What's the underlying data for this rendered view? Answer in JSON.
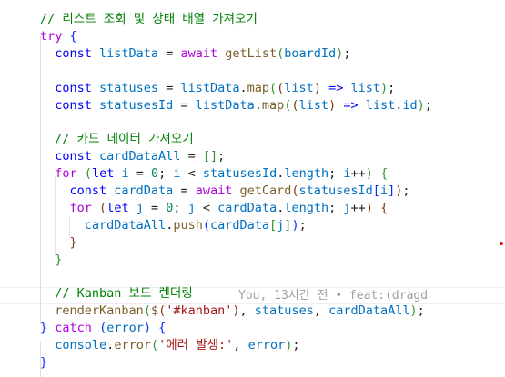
{
  "editor": {
    "lines": [
      [
        {
          "t": "// 리스트 조회 및 상태 배열 가져오기",
          "c": "comment"
        }
      ],
      [
        {
          "t": "try",
          "c": "keyword"
        },
        {
          "t": " {",
          "c": "b1"
        }
      ],
      [
        {
          "t": "  "
        },
        {
          "t": "const",
          "c": "decl"
        },
        {
          "t": " listData",
          "c": "var"
        },
        {
          "t": " = "
        },
        {
          "t": "await",
          "c": "keyword"
        },
        {
          "t": " getList",
          "c": "fn"
        },
        {
          "t": "(",
          "c": "b2"
        },
        {
          "t": "boardId",
          "c": "var"
        },
        {
          "t": ")",
          "c": "b2"
        },
        {
          "t": ";"
        }
      ],
      [],
      [
        {
          "t": "  "
        },
        {
          "t": "const",
          "c": "decl"
        },
        {
          "t": " statuses",
          "c": "var"
        },
        {
          "t": " = "
        },
        {
          "t": "listData",
          "c": "var"
        },
        {
          "t": "."
        },
        {
          "t": "map",
          "c": "fn"
        },
        {
          "t": "(",
          "c": "b2"
        },
        {
          "t": "(",
          "c": "b3"
        },
        {
          "t": "list",
          "c": "var"
        },
        {
          "t": ")",
          "c": "b3"
        },
        {
          "t": " "
        },
        {
          "t": "=>",
          "c": "decl"
        },
        {
          "t": " list",
          "c": "var"
        },
        {
          "t": ")",
          "c": "b2"
        },
        {
          "t": ";"
        }
      ],
      [
        {
          "t": "  "
        },
        {
          "t": "const",
          "c": "decl"
        },
        {
          "t": " statusesId",
          "c": "var"
        },
        {
          "t": " = "
        },
        {
          "t": "listData",
          "c": "var"
        },
        {
          "t": "."
        },
        {
          "t": "map",
          "c": "fn"
        },
        {
          "t": "(",
          "c": "b2"
        },
        {
          "t": "(",
          "c": "b3"
        },
        {
          "t": "list",
          "c": "var"
        },
        {
          "t": ")",
          "c": "b3"
        },
        {
          "t": " "
        },
        {
          "t": "=>",
          "c": "decl"
        },
        {
          "t": " list",
          "c": "var"
        },
        {
          "t": "."
        },
        {
          "t": "id",
          "c": "var"
        },
        {
          "t": ")",
          "c": "b2"
        },
        {
          "t": ";"
        }
      ],
      [],
      [
        {
          "t": "  "
        },
        {
          "t": "// 카드 데이터 가져오기",
          "c": "comment"
        }
      ],
      [
        {
          "t": "  "
        },
        {
          "t": "const",
          "c": "decl"
        },
        {
          "t": " cardDataAll",
          "c": "var"
        },
        {
          "t": " = "
        },
        {
          "t": "[]",
          "c": "b2"
        },
        {
          "t": ";"
        }
      ],
      [
        {
          "t": "  "
        },
        {
          "t": "for",
          "c": "keyword"
        },
        {
          "t": " "
        },
        {
          "t": "(",
          "c": "b2"
        },
        {
          "t": "let",
          "c": "decl"
        },
        {
          "t": " i",
          "c": "var"
        },
        {
          "t": " = "
        },
        {
          "t": "0",
          "c": "number"
        },
        {
          "t": "; "
        },
        {
          "t": "i",
          "c": "var"
        },
        {
          "t": " < "
        },
        {
          "t": "statusesId",
          "c": "var"
        },
        {
          "t": "."
        },
        {
          "t": "length",
          "c": "var"
        },
        {
          "t": "; "
        },
        {
          "t": "i",
          "c": "var"
        },
        {
          "t": "++"
        },
        {
          "t": ")",
          "c": "b2"
        },
        {
          "t": " "
        },
        {
          "t": "{",
          "c": "b2"
        }
      ],
      [
        {
          "t": "    "
        },
        {
          "t": "const",
          "c": "decl"
        },
        {
          "t": " cardData",
          "c": "var"
        },
        {
          "t": " = "
        },
        {
          "t": "await",
          "c": "keyword"
        },
        {
          "t": " getCard",
          "c": "fn"
        },
        {
          "t": "(",
          "c": "b3"
        },
        {
          "t": "statusesId",
          "c": "var"
        },
        {
          "t": "[",
          "c": "b1"
        },
        {
          "t": "i",
          "c": "var"
        },
        {
          "t": "]",
          "c": "b1"
        },
        {
          "t": ")",
          "c": "b3"
        },
        {
          "t": ";"
        }
      ],
      [
        {
          "t": "    "
        },
        {
          "t": "for",
          "c": "keyword"
        },
        {
          "t": " "
        },
        {
          "t": "(",
          "c": "b3"
        },
        {
          "t": "let",
          "c": "decl"
        },
        {
          "t": " j",
          "c": "var"
        },
        {
          "t": " = "
        },
        {
          "t": "0",
          "c": "number"
        },
        {
          "t": "; "
        },
        {
          "t": "j",
          "c": "var"
        },
        {
          "t": " < "
        },
        {
          "t": "cardData",
          "c": "var"
        },
        {
          "t": "."
        },
        {
          "t": "length",
          "c": "var"
        },
        {
          "t": "; "
        },
        {
          "t": "j",
          "c": "var"
        },
        {
          "t": "++"
        },
        {
          "t": ")",
          "c": "b3"
        },
        {
          "t": " "
        },
        {
          "t": "{",
          "c": "b3"
        }
      ],
      [
        {
          "t": "      "
        },
        {
          "t": "cardDataAll",
          "c": "var"
        },
        {
          "t": "."
        },
        {
          "t": "push",
          "c": "fn"
        },
        {
          "t": "(",
          "c": "b1"
        },
        {
          "t": "cardData",
          "c": "var"
        },
        {
          "t": "[",
          "c": "b2"
        },
        {
          "t": "j",
          "c": "var"
        },
        {
          "t": "]",
          "c": "b2"
        },
        {
          "t": ")",
          "c": "b1"
        },
        {
          "t": ";"
        }
      ],
      [
        {
          "t": "    "
        },
        {
          "t": "}",
          "c": "b3"
        }
      ],
      [
        {
          "t": "  "
        },
        {
          "t": "}",
          "c": "b2"
        }
      ],
      [],
      [
        {
          "t": "  "
        },
        {
          "t": "// Kanban 보드 렌더링",
          "c": "comment"
        }
      ],
      [
        {
          "t": "  "
        },
        {
          "t": "renderKanban",
          "c": "fn"
        },
        {
          "t": "(",
          "c": "b2"
        },
        {
          "t": "$",
          "c": "fn"
        },
        {
          "t": "(",
          "c": "b3"
        },
        {
          "t": "'#kanban'",
          "c": "string"
        },
        {
          "t": ")",
          "c": "b3"
        },
        {
          "t": ", "
        },
        {
          "t": "statuses",
          "c": "var"
        },
        {
          "t": ", "
        },
        {
          "t": "cardDataAll",
          "c": "var"
        },
        {
          "t": ")",
          "c": "b2"
        },
        {
          "t": ";"
        }
      ],
      [
        {
          "t": "}",
          "c": "b1"
        },
        {
          "t": " "
        },
        {
          "t": "catch",
          "c": "keyword"
        },
        {
          "t": " "
        },
        {
          "t": "(",
          "c": "b1"
        },
        {
          "t": "error",
          "c": "var"
        },
        {
          "t": ")",
          "c": "b1"
        },
        {
          "t": " "
        },
        {
          "t": "{",
          "c": "b1"
        }
      ],
      [
        {
          "t": "  "
        },
        {
          "t": "console",
          "c": "var"
        },
        {
          "t": "."
        },
        {
          "t": "error",
          "c": "fn"
        },
        {
          "t": "(",
          "c": "b2"
        },
        {
          "t": "'에러 발생:'",
          "c": "string"
        },
        {
          "t": ", "
        },
        {
          "t": "error",
          "c": "var"
        },
        {
          "t": ")",
          "c": "b2"
        },
        {
          "t": ";"
        }
      ],
      [
        {
          "t": "}",
          "c": "b1"
        }
      ]
    ],
    "blame_text": "You, 13시간 전 • feat:(dragd",
    "colors": {
      "comment": "#008000",
      "keyword": "#af00db",
      "decl": "#0000ff",
      "variable": "#0070c1",
      "function": "#795e26",
      "string": "#a31515",
      "number": "#098658",
      "bracket_level1": "#0431fa",
      "bracket_level2": "#319331",
      "bracket_level3": "#7b3814",
      "error_marker": "#e51400"
    }
  }
}
